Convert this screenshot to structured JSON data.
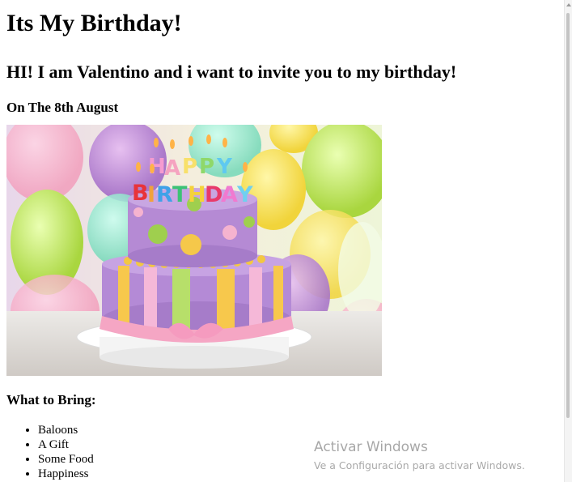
{
  "page": {
    "title": "Its My Birthday!",
    "invite": "HI! I am Valentino and i want to invite you to my birthday!",
    "date": "On The 8th August",
    "bring_heading": "What to Bring:",
    "bring_items": [
      "Baloons",
      "A Gift",
      "Some Food",
      "Happiness"
    ]
  },
  "image": {
    "subject": "birthday-cake-photo",
    "cake_topper_text": "HAPPY BIRTHDAY"
  },
  "watermark": {
    "title": "Activar Windows",
    "subtitle": "Ve a Configuración para activar Windows."
  }
}
